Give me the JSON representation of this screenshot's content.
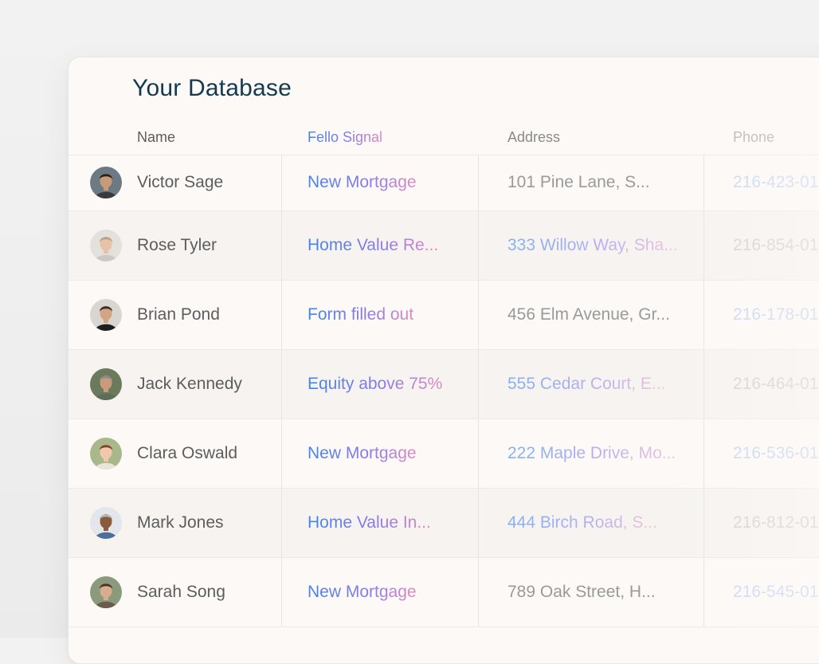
{
  "title": "Your Database",
  "columns": {
    "name": "Name",
    "signal": "Fello Signal",
    "address": "Address",
    "phone": "Phone"
  },
  "rows": [
    {
      "name": "Victor Sage",
      "signal": "New Mortgage",
      "address": "101 Pine Lane, S...",
      "phone": "216-423-01",
      "skin": "#c89a78",
      "hair": "#2b2019",
      "shirt": "#3a3a3a",
      "bg": "#6b7a83"
    },
    {
      "name": "Rose Tyler",
      "signal": "Home Value Re...",
      "address": "333 Willow Way, Sha...",
      "phone": "216-854-01",
      "skin": "#e6c3a8",
      "hair": "#b9a28c",
      "shirt": "#c9c9c9",
      "bg": "#e4e0dc"
    },
    {
      "name": "Brian Pond",
      "signal": "Form filled out",
      "address": "456 Elm Avenue, Gr...",
      "phone": "216-178-01",
      "skin": "#d4a585",
      "hair": "#3c2c22",
      "shirt": "#1e1e1e",
      "bg": "#d9d6d2"
    },
    {
      "name": "Jack Kennedy",
      "signal": "Equity above 75%",
      "address": "555 Cedar Court, E...",
      "phone": "216-464-01",
      "skin": "#c99b7c",
      "hair": "#8a8a8a",
      "shirt": "#5c6e5a",
      "bg": "#6a7a5a"
    },
    {
      "name": "Clara Oswald",
      "signal": "New Mortgage",
      "address": "222 Maple Drive, Mo...",
      "phone": "216-536-01",
      "skin": "#efc9ae",
      "hair": "#8b3f22",
      "shirt": "#e9e3da",
      "bg": "#a9b88a"
    },
    {
      "name": "Mark Jones",
      "signal": "Home Value In...",
      "address": "444 Birch Road, S...",
      "phone": "216-812-01",
      "skin": "#8a5a3d",
      "hair": "#b9b9b9",
      "shirt": "#4e6f9a",
      "bg": "#e3e6ea"
    },
    {
      "name": "Sarah Song",
      "signal": "New Mortgage",
      "address": "789 Oak Street, H...",
      "phone": "216-545-01",
      "skin": "#d8ac8e",
      "hair": "#4a3122",
      "shirt": "#6b5b4d",
      "bg": "#8c9a7c"
    }
  ]
}
